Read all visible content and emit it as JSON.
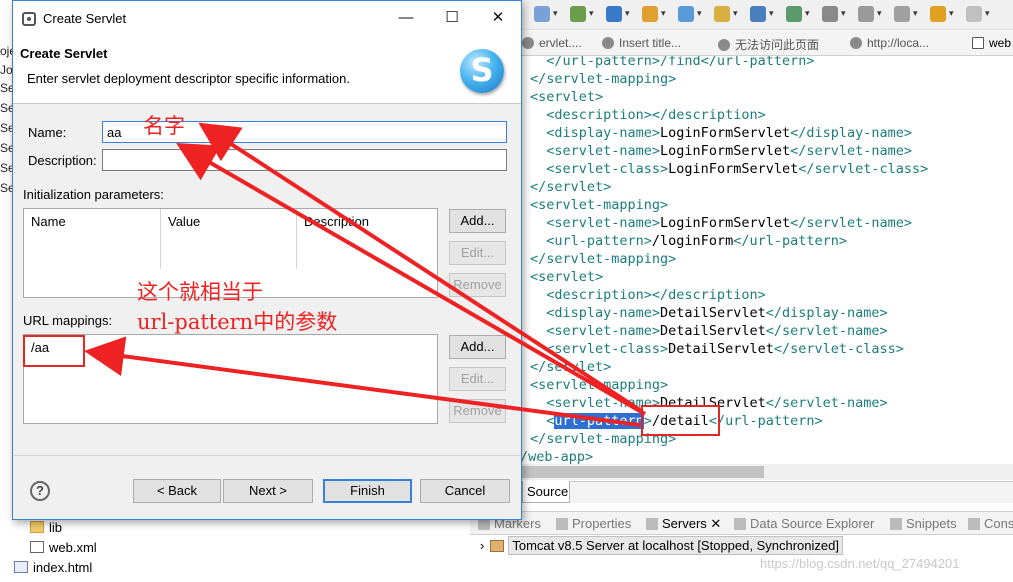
{
  "dialog": {
    "window_title": "Create Servlet",
    "banner_title": "Create Servlet",
    "banner_desc": "Enter servlet deployment descriptor specific information.",
    "logo_letter": "S",
    "name_label": "Name:",
    "name_value": "aa",
    "description_label": "Description:",
    "description_value": "",
    "init_params_label": "Initialization parameters:",
    "init_columns": [
      "Name",
      "Value",
      "Description"
    ],
    "url_mappings_label": "URL mappings:",
    "url_mappings": [
      "/aa"
    ],
    "side_buttons": {
      "add": "Add...",
      "edit": "Edit...",
      "remove": "Remove"
    },
    "footer": {
      "help": "?",
      "back": "< Back",
      "next": "Next >",
      "finish": "Finish",
      "cancel": "Cancel"
    },
    "window_controls": {
      "minimize": "—",
      "maximize": "☐",
      "close": "✕"
    }
  },
  "annotations": {
    "name_note": "名字",
    "url_note_line1": "这个就相当于",
    "url_note_line2": "url-pattern中的参数"
  },
  "editor": {
    "tabs": [
      "ervlet....",
      "Insert title...",
      "无法访问此页面",
      "http://loca...",
      "web"
    ],
    "code_lines": [
      [
        {
          "t": "  </url-pattern>/find</url-pattern>",
          "c": "tg"
        }
      ],
      [
        {
          "t": "</servlet-mapping>",
          "c": "tg"
        }
      ],
      [
        {
          "t": "<servlet>",
          "c": "tg"
        }
      ],
      [
        {
          "t": "  <description></description>",
          "c": "tg"
        }
      ],
      [
        {
          "t": "  <display-name>",
          "c": "tg"
        },
        {
          "t": "LoginFormServlet",
          "c": "tx"
        },
        {
          "t": "</display-name>",
          "c": "tg"
        }
      ],
      [
        {
          "t": "  <servlet-name>",
          "c": "tg"
        },
        {
          "t": "LoginFormServlet",
          "c": "tx"
        },
        {
          "t": "</servlet-name>",
          "c": "tg"
        }
      ],
      [
        {
          "t": "  <servlet-class>",
          "c": "tg"
        },
        {
          "t": "LoginFormServlet",
          "c": "tx"
        },
        {
          "t": "</servlet-class>",
          "c": "tg"
        }
      ],
      [
        {
          "t": "</servlet>",
          "c": "tg"
        }
      ],
      [
        {
          "t": "<servlet-mapping>",
          "c": "tg"
        }
      ],
      [
        {
          "t": "  <servlet-name>",
          "c": "tg"
        },
        {
          "t": "LoginFormServlet",
          "c": "tx"
        },
        {
          "t": "</servlet-name>",
          "c": "tg"
        }
      ],
      [
        {
          "t": "  <url-pattern>",
          "c": "tg"
        },
        {
          "t": "/loginForm",
          "c": "tx"
        },
        {
          "t": "</url-pattern>",
          "c": "tg"
        }
      ],
      [
        {
          "t": "</servlet-mapping>",
          "c": "tg"
        }
      ],
      [
        {
          "t": "<servlet>",
          "c": "tg"
        }
      ],
      [
        {
          "t": "  <description></description>",
          "c": "tg"
        }
      ],
      [
        {
          "t": "  <display-name>",
          "c": "tg"
        },
        {
          "t": "DetailServlet",
          "c": "tx"
        },
        {
          "t": "</display-name>",
          "c": "tg"
        }
      ],
      [
        {
          "t": "  <servlet-name>",
          "c": "tg"
        },
        {
          "t": "DetailServlet",
          "c": "tx"
        },
        {
          "t": "</servlet-name>",
          "c": "tg"
        }
      ],
      [
        {
          "t": "  <servlet-class>",
          "c": "tg"
        },
        {
          "t": "DetailServlet",
          "c": "tx"
        },
        {
          "t": "</servlet-class>",
          "c": "tg"
        }
      ],
      [
        {
          "t": "</servlet>",
          "c": "tg"
        }
      ],
      [
        {
          "t": "<servlet-mapping>",
          "c": "tg"
        }
      ],
      [
        {
          "t": "  <servlet-name>",
          "c": "tg"
        },
        {
          "t": "DetailServlet",
          "c": "tx"
        },
        {
          "t": "</servlet-name>",
          "c": "tg"
        }
      ],
      [
        {
          "t": "  <",
          "c": "tg"
        },
        {
          "t": "url-pattern",
          "c": "hl-tag"
        },
        {
          "t": ">",
          "c": "tg"
        },
        {
          "t": "/detail",
          "c": "tx"
        },
        {
          "t": "</",
          "c": "tg"
        },
        {
          "t": "url-pattern",
          "c": "tg"
        },
        {
          "t": ">",
          "c": "tg"
        }
      ],
      [
        {
          "t": "</servlet-mapping>",
          "c": "tg"
        }
      ],
      [
        {
          "t": "/web-app>",
          "c": "tg"
        }
      ]
    ],
    "source_tab": "Source"
  },
  "bottom_panel": {
    "tabs": [
      "Markers",
      "Properties",
      "Servers",
      "Data Source Explorer",
      "Snippets",
      "Cons"
    ],
    "active_tab": "Servers",
    "server_entry": "Tomcat v8.5 Server at localhost  [Stopped, Synchronized]"
  },
  "project_tree": {
    "items": [
      "lib",
      "web.xml",
      "index.html"
    ]
  },
  "left_strip_text": [
    "oje",
    "Jo",
    "Se",
    "Se",
    "Se",
    "Se",
    "Se",
    "Se"
  ],
  "watermark": "https://blog.csdn.net/qq_27494201"
}
